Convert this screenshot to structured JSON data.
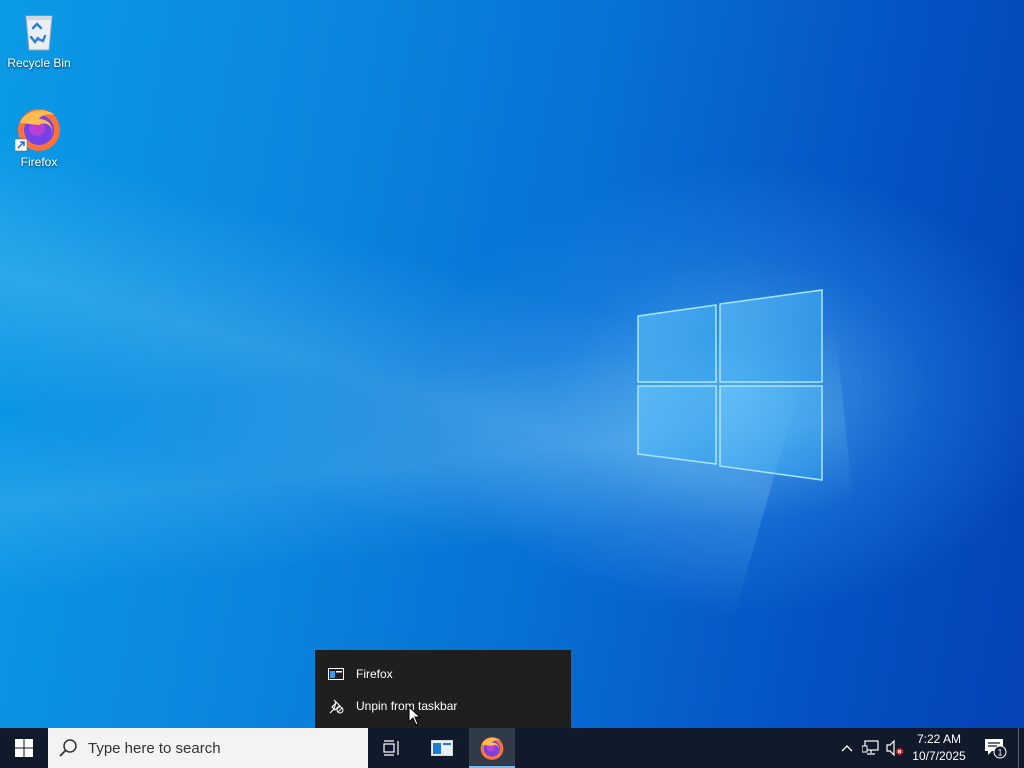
{
  "desktop": {
    "icons": [
      {
        "label": "Recycle Bin",
        "icon": "recycle-bin-icon"
      },
      {
        "label": "Firefox",
        "icon": "firefox-icon"
      }
    ]
  },
  "context_menu": {
    "items": [
      {
        "label": "Firefox",
        "icon": "window-icon"
      },
      {
        "label": "Unpin from taskbar",
        "icon": "unpin-icon"
      }
    ]
  },
  "taskbar": {
    "search_placeholder": "Type here to search",
    "pinned": [
      {
        "name": "task-view",
        "icon": "task-view-icon"
      },
      {
        "name": "app-window",
        "icon": "window-icon"
      },
      {
        "name": "firefox",
        "icon": "firefox-icon",
        "active": true
      }
    ],
    "tray": {
      "time": "7:22 AM",
      "date": "10/7/2025",
      "notification_count": "1",
      "icons": [
        "chevron-up-icon",
        "network-icon",
        "volume-muted-icon"
      ]
    }
  },
  "colors": {
    "taskbar": "#101a2b",
    "menu": "#1f1f1f",
    "accent": "#76b9ed"
  }
}
